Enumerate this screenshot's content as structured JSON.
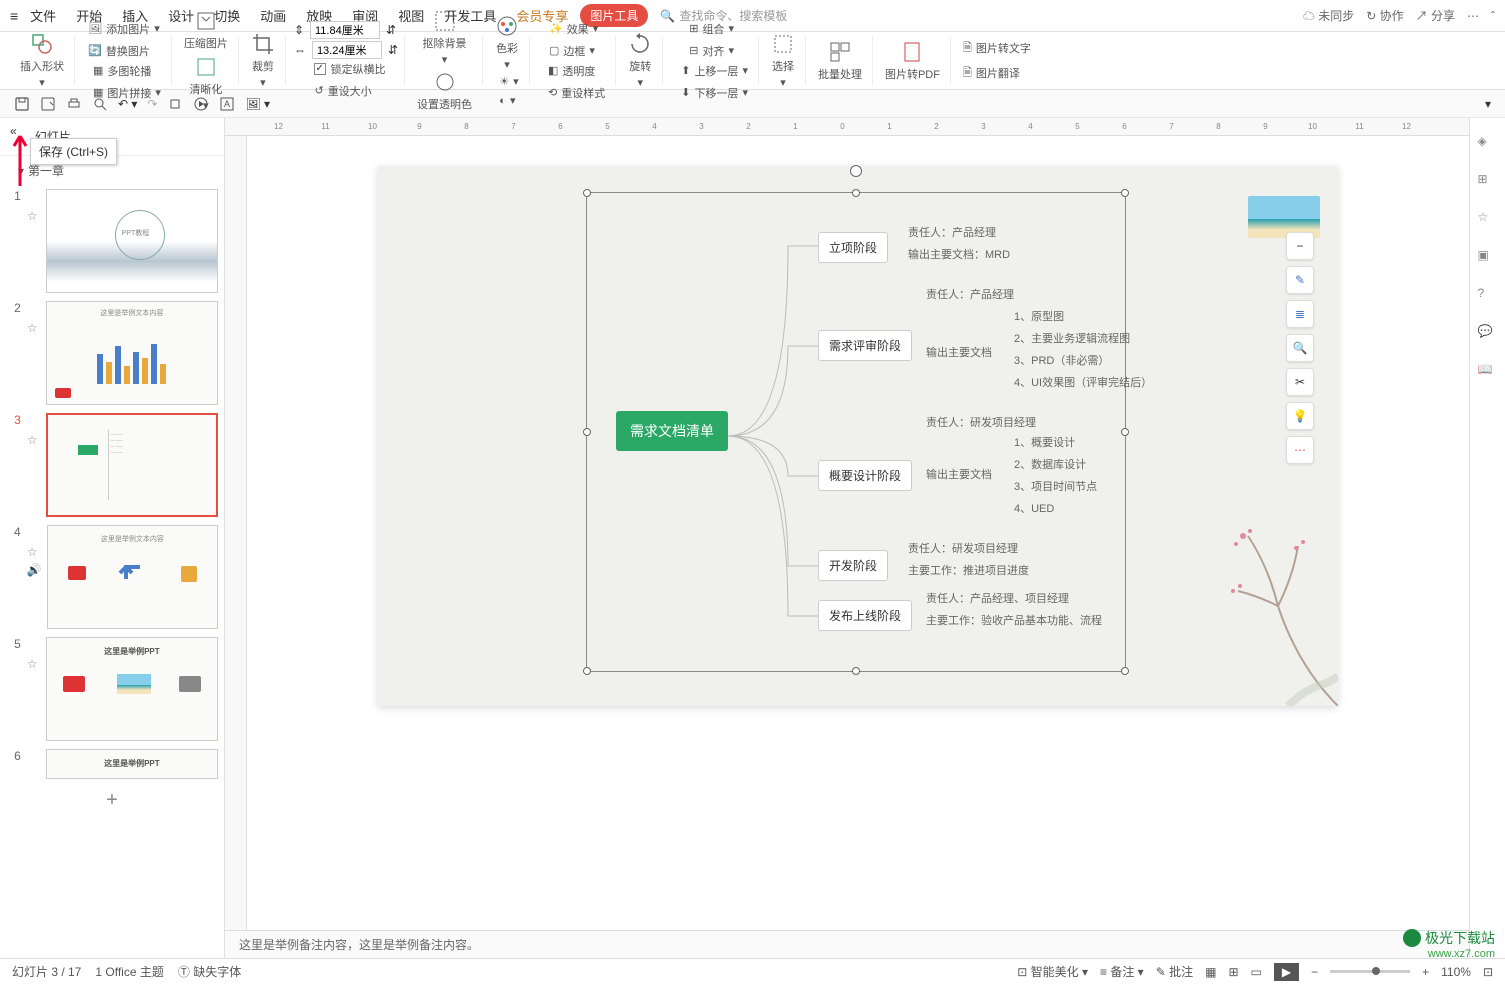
{
  "menu": {
    "items": [
      "文件",
      "开始",
      "插入",
      "设计",
      "切换",
      "动画",
      "放映",
      "审阅",
      "视图",
      "开发工具",
      "会员专享"
    ],
    "pic_tool": "图片工具",
    "search_placeholder": "查找命令、搜索模板",
    "unsync": "未同步",
    "collab": "协作",
    "share": "分享"
  },
  "ribbon": {
    "insert_shape": "插入形状",
    "add_pic": "添加图片",
    "multi_pic": "多图轮播",
    "replace_pic": "替换图片",
    "pic_stitch": "图片拼接",
    "compress": "压缩图片",
    "clarity": "清晰化",
    "crop": "裁剪",
    "width_val": "11.84厘米",
    "height_val": "13.24厘米",
    "lock_ratio": "锁定纵横比",
    "reset_size": "重设大小",
    "remove_bg": "抠除背景",
    "set_trans": "设置透明色",
    "color": "色彩",
    "effect": "效果",
    "transparency": "透明度",
    "border": "边框",
    "reset_style": "重设样式",
    "rotate": "旋转",
    "group": "组合",
    "align": "对齐",
    "up_layer": "上移一层",
    "down_layer": "下移一层",
    "select": "选择",
    "batch": "批量处理",
    "pic2pdf": "图片转PDF",
    "pic2text": "图片转文字",
    "pic_translate": "图片翻译"
  },
  "tooltip": {
    "save": "保存 (Ctrl+S)"
  },
  "slides": {
    "tab1": "幻灯片",
    "section": "第一章",
    "titles": [
      "PPT教程",
      "这里是举例文本内容",
      "",
      "这里是举例文本内容",
      "这里是举例PPT",
      "这里是举例PPT"
    ]
  },
  "mindmap": {
    "root": "需求文档清单",
    "n1": "立项阶段",
    "n1_a": "责任人：产品经理",
    "n1_b": "输出主要文档：MRD",
    "n2": "需求评审阶段",
    "n2_a": "责任人：产品经理",
    "n2_b": "输出主要文档",
    "n2_c1": "1、原型图",
    "n2_c2": "2、主要业务逻辑流程图",
    "n2_c3": "3、PRD（非必需）",
    "n2_c4": "4、UI效果图（评审完结后）",
    "n3": "概要设计阶段",
    "n3_a": "责任人：研发项目经理",
    "n3_b": "输出主要文档",
    "n3_c1": "1、概要设计",
    "n3_c2": "2、数据库设计",
    "n3_c3": "3、项目时间节点",
    "n3_c4": "4、UED",
    "n4": "开发阶段",
    "n4_a": "责任人：研发项目经理",
    "n4_b": "主要工作：推进项目进度",
    "n5": "发布上线阶段",
    "n5_a": "责任人：产品经理、项目经理",
    "n5_b": "主要工作：验收产品基本功能、流程"
  },
  "notes": "这里是举例备注内容，这里是举例备注内容。",
  "status": {
    "slide_pos": "幻灯片 3 / 17",
    "theme": "1 Office 主题",
    "missing_font": "缺失字体",
    "beautify": "智能美化",
    "notes_btn": "备注",
    "comment_btn": "批注",
    "zoom": "110%"
  },
  "ruler_h": [
    "12",
    "11",
    "10",
    "9",
    "8",
    "7",
    "6",
    "5",
    "4",
    "3",
    "2",
    "1",
    "0",
    "1",
    "2",
    "3",
    "4",
    "5",
    "6",
    "7",
    "8",
    "9",
    "10",
    "11",
    "12"
  ],
  "watermark": {
    "name": "极光下载站",
    "url": "www.xz7.com"
  }
}
